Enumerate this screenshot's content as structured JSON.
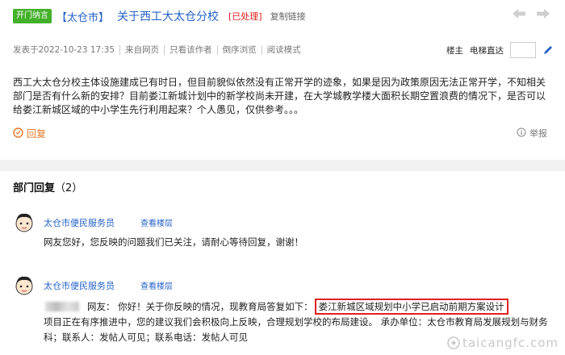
{
  "post": {
    "badge": "开门纳言",
    "city": "【太仓市】",
    "title": "关于西工大太仓分校",
    "status": "[已处理]",
    "copy_link": "复制链接"
  },
  "meta": {
    "posted": "发表于2022-10-23 17:35",
    "source": "来自网页",
    "only_author": "只看该作者",
    "reverse": "倒序浏览",
    "read_mode": "阅读模式",
    "floor_owner": "楼主",
    "elevator": "电梯直达",
    "elevator_value": ""
  },
  "content": {
    "text": "西工大太仓分校主体设施建成已有时日，但目前貌似依然没有正常开学的迹象，如果是因为政策原因无法正常开学，不知相关部门是否有什么新的安排？目前娄江新城计划中的新学校尚未开建，在大学城教学楼大面积长期空置浪费的情况下，是否可以给娄江新城区域的中小学生先行利用起来？个人愚见，仅供参考。。。",
    "reply_label": "回复",
    "report_label": "举报"
  },
  "dept": {
    "title": "部门回复",
    "count": "（2）"
  },
  "replies": [
    {
      "name": "太仓市便民服务员",
      "floor_link": "查看楼层",
      "text": "网友您好，您反映的问题我们已关注，请耐心等待回复，谢谢！"
    },
    {
      "name": "太仓市便民服务员",
      "floor_link": "查看楼层",
      "prefix": "网友： 你好！关于你反映的情况，现教育局答复如下：",
      "highlight": "娄江新城区域规划中小学已启动前期方案设计",
      "rest": "项目正在有序推进中，您的建议我们会积极向上反映，合理规划学校的布局建设。 承办单位：太仓市教育局发展规划与财务科；联系人：发帖人可见；联系电话：发帖人可见"
    }
  ],
  "watermark": "taicangfc.com",
  "colors": {
    "badge_green": "#43b02a",
    "link_blue": "#2561c7",
    "status_red": "#e02020",
    "reply_orange": "#e47829"
  },
  "icons": {
    "prev": "arrow-left-icon",
    "next": "arrow-right-icon",
    "jump": "pen-icon",
    "reply": "reply-icon",
    "report": "info-icon",
    "avatar": "avatar-icon"
  }
}
